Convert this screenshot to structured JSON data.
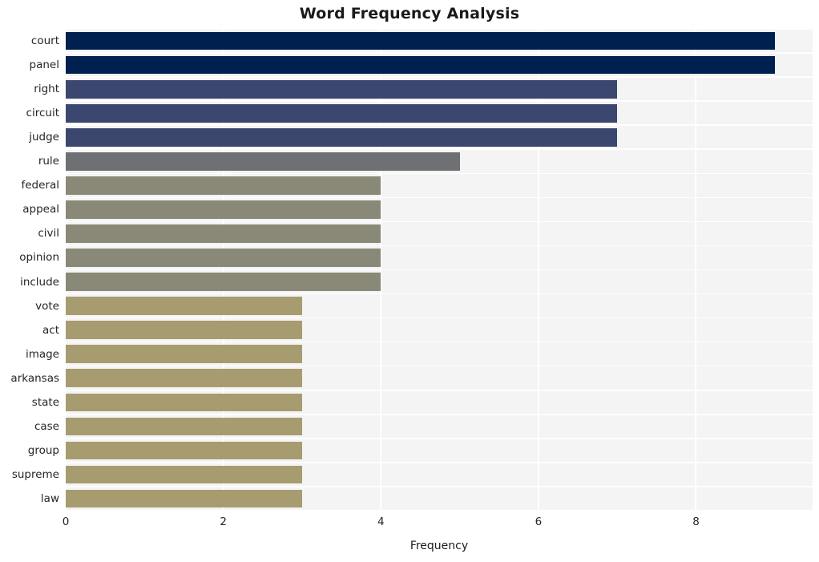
{
  "chart_data": {
    "type": "bar",
    "orientation": "horizontal",
    "title": "Word Frequency Analysis",
    "xlabel": "Frequency",
    "ylabel": "",
    "categories": [
      "court",
      "panel",
      "right",
      "circuit",
      "judge",
      "rule",
      "federal",
      "appeal",
      "civil",
      "opinion",
      "include",
      "vote",
      "act",
      "image",
      "arkansas",
      "state",
      "case",
      "group",
      "supreme",
      "law"
    ],
    "values": [
      9,
      9,
      7,
      7,
      7,
      5,
      4,
      4,
      4,
      4,
      4,
      3,
      3,
      3,
      3,
      3,
      3,
      3,
      3,
      3
    ],
    "bar_colors": [
      "#002050",
      "#002050",
      "#3c4770",
      "#3c4770",
      "#3c4770",
      "#6e7074",
      "#8a8877",
      "#8a8877",
      "#8a8877",
      "#8a8877",
      "#8a8877",
      "#a79c6f",
      "#a79c6f",
      "#a79c6f",
      "#a79c6f",
      "#a79c6f",
      "#a79c6f",
      "#a79c6f",
      "#a79c6f",
      "#a79c6f"
    ],
    "xlim": [
      0,
      9.48
    ],
    "xticks": [
      0,
      2,
      4,
      6,
      8
    ],
    "xtick_labels": [
      "0",
      "2",
      "4",
      "6",
      "8"
    ],
    "grid": true,
    "grid_color": "#ffffff",
    "plot_background": "#f4f4f5",
    "figure_background": "#ffffff",
    "legend": null
  }
}
